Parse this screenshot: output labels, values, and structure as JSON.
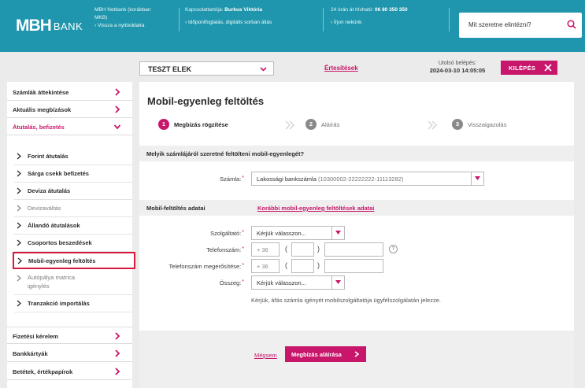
{
  "header": {
    "logo_mark": "MBH",
    "logo_text": "BANK",
    "col1": {
      "line1": "MBH Netbank (korábban",
      "line2": "MKB)",
      "back_link": "Vissza a nyitóoldalra"
    },
    "col2": {
      "contact_prefix": "Kapcsolattartója:",
      "contact_name": "Burkus Viktória",
      "booking_link": "Időpontfoglalás, digitális sorban állás"
    },
    "col3": {
      "hotline_prefix": "24 órán át hívható:",
      "hotline_number": "06 80 350 350",
      "write_link": "Írjon nekünk"
    },
    "search_placeholder": "Mit szeretne elintézni?"
  },
  "subbar": {
    "user_name": "TESZT ELEK",
    "notifications": "Értesítések",
    "last_login_label": "Utolsó belépés:",
    "last_login_time": "2024-03-10 14:05:05",
    "logout": "KILÉPÉS"
  },
  "sidebar": {
    "top_items": [
      {
        "label": "Számlák áttekintése"
      },
      {
        "label": "Aktuális megbízások"
      },
      {
        "label": "Átutalás, befizetés"
      }
    ],
    "sub_items": [
      {
        "label": "Forint átutalás"
      },
      {
        "label": "Sárga csekk befizetés"
      },
      {
        "label": "Deviza átutalás"
      },
      {
        "label": "Devizaváltás"
      },
      {
        "label": "Állandó átutalások"
      },
      {
        "label": "Csoportos beszedések"
      },
      {
        "label": "Mobil-egyenleg feltöltés"
      },
      {
        "label_line1": "Autópálya matrica",
        "label_line2": "igénylés"
      },
      {
        "label": "Tranzakció importálás"
      }
    ],
    "bottom_items": [
      {
        "label": "Fizetési kérelem"
      },
      {
        "label": "Bankkártyák"
      },
      {
        "label": "Betétek, értékpapírok"
      }
    ]
  },
  "main": {
    "title": "Mobil-egyenleg feltöltés",
    "steps": [
      {
        "num": "1",
        "label": "Megbízás rögzítése"
      },
      {
        "num": "2",
        "label": "Aláírás"
      },
      {
        "num": "3",
        "label": "Visszaigazolás"
      }
    ],
    "account_section": {
      "heading": "Melyik számlájáról szeretné feltölteni mobil-egyenlegét?",
      "account_label": "Számla:",
      "account_name": "Lakossági bankszámla",
      "account_number": "(10300002-22222222-11113282)"
    },
    "topup_section": {
      "heading": "Mobil-feltöltés adatai",
      "history_link": "Korábbi mobil-egyenleg feltöltések adatai",
      "provider_label": "Szolgáltató:",
      "provider_value": "Kérjük válasszon...",
      "phone_label": "Telefonszám:",
      "phone_confirm_label": "Telefonszám megerősítése:",
      "country_code": "+ 36",
      "help": "?",
      "amount_label": "Összeg:",
      "amount_value": "Kérjük válasszon...",
      "invoice_note": "Kérjük, áfás számla igényét mobilszolgáltatója ügyfélszolgálatán jelezze."
    },
    "footer": {
      "cancel": "Mégsem",
      "sign": "Megbízás aláírása"
    }
  },
  "colors": {
    "brand_teal": "#1f96ad",
    "accent_magenta": "#c8166b",
    "highlight_red": "#d8183d"
  }
}
